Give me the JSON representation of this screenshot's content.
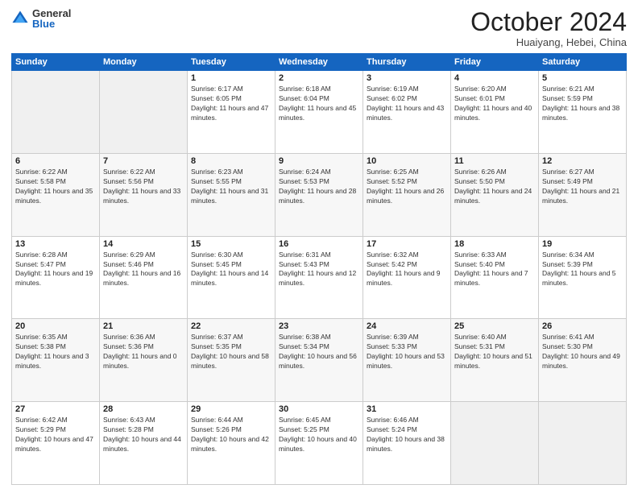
{
  "header": {
    "logo_general": "General",
    "logo_blue": "Blue",
    "month_title": "October 2024",
    "subtitle": "Huaiyang, Hebei, China"
  },
  "days_of_week": [
    "Sunday",
    "Monday",
    "Tuesday",
    "Wednesday",
    "Thursday",
    "Friday",
    "Saturday"
  ],
  "weeks": [
    [
      {
        "day": "",
        "info": ""
      },
      {
        "day": "",
        "info": ""
      },
      {
        "day": "1",
        "info": "Sunrise: 6:17 AM\nSunset: 6:05 PM\nDaylight: 11 hours and 47 minutes."
      },
      {
        "day": "2",
        "info": "Sunrise: 6:18 AM\nSunset: 6:04 PM\nDaylight: 11 hours and 45 minutes."
      },
      {
        "day": "3",
        "info": "Sunrise: 6:19 AM\nSunset: 6:02 PM\nDaylight: 11 hours and 43 minutes."
      },
      {
        "day": "4",
        "info": "Sunrise: 6:20 AM\nSunset: 6:01 PM\nDaylight: 11 hours and 40 minutes."
      },
      {
        "day": "5",
        "info": "Sunrise: 6:21 AM\nSunset: 5:59 PM\nDaylight: 11 hours and 38 minutes."
      }
    ],
    [
      {
        "day": "6",
        "info": "Sunrise: 6:22 AM\nSunset: 5:58 PM\nDaylight: 11 hours and 35 minutes."
      },
      {
        "day": "7",
        "info": "Sunrise: 6:22 AM\nSunset: 5:56 PM\nDaylight: 11 hours and 33 minutes."
      },
      {
        "day": "8",
        "info": "Sunrise: 6:23 AM\nSunset: 5:55 PM\nDaylight: 11 hours and 31 minutes."
      },
      {
        "day": "9",
        "info": "Sunrise: 6:24 AM\nSunset: 5:53 PM\nDaylight: 11 hours and 28 minutes."
      },
      {
        "day": "10",
        "info": "Sunrise: 6:25 AM\nSunset: 5:52 PM\nDaylight: 11 hours and 26 minutes."
      },
      {
        "day": "11",
        "info": "Sunrise: 6:26 AM\nSunset: 5:50 PM\nDaylight: 11 hours and 24 minutes."
      },
      {
        "day": "12",
        "info": "Sunrise: 6:27 AM\nSunset: 5:49 PM\nDaylight: 11 hours and 21 minutes."
      }
    ],
    [
      {
        "day": "13",
        "info": "Sunrise: 6:28 AM\nSunset: 5:47 PM\nDaylight: 11 hours and 19 minutes."
      },
      {
        "day": "14",
        "info": "Sunrise: 6:29 AM\nSunset: 5:46 PM\nDaylight: 11 hours and 16 minutes."
      },
      {
        "day": "15",
        "info": "Sunrise: 6:30 AM\nSunset: 5:45 PM\nDaylight: 11 hours and 14 minutes."
      },
      {
        "day": "16",
        "info": "Sunrise: 6:31 AM\nSunset: 5:43 PM\nDaylight: 11 hours and 12 minutes."
      },
      {
        "day": "17",
        "info": "Sunrise: 6:32 AM\nSunset: 5:42 PM\nDaylight: 11 hours and 9 minutes."
      },
      {
        "day": "18",
        "info": "Sunrise: 6:33 AM\nSunset: 5:40 PM\nDaylight: 11 hours and 7 minutes."
      },
      {
        "day": "19",
        "info": "Sunrise: 6:34 AM\nSunset: 5:39 PM\nDaylight: 11 hours and 5 minutes."
      }
    ],
    [
      {
        "day": "20",
        "info": "Sunrise: 6:35 AM\nSunset: 5:38 PM\nDaylight: 11 hours and 3 minutes."
      },
      {
        "day": "21",
        "info": "Sunrise: 6:36 AM\nSunset: 5:36 PM\nDaylight: 11 hours and 0 minutes."
      },
      {
        "day": "22",
        "info": "Sunrise: 6:37 AM\nSunset: 5:35 PM\nDaylight: 10 hours and 58 minutes."
      },
      {
        "day": "23",
        "info": "Sunrise: 6:38 AM\nSunset: 5:34 PM\nDaylight: 10 hours and 56 minutes."
      },
      {
        "day": "24",
        "info": "Sunrise: 6:39 AM\nSunset: 5:33 PM\nDaylight: 10 hours and 53 minutes."
      },
      {
        "day": "25",
        "info": "Sunrise: 6:40 AM\nSunset: 5:31 PM\nDaylight: 10 hours and 51 minutes."
      },
      {
        "day": "26",
        "info": "Sunrise: 6:41 AM\nSunset: 5:30 PM\nDaylight: 10 hours and 49 minutes."
      }
    ],
    [
      {
        "day": "27",
        "info": "Sunrise: 6:42 AM\nSunset: 5:29 PM\nDaylight: 10 hours and 47 minutes."
      },
      {
        "day": "28",
        "info": "Sunrise: 6:43 AM\nSunset: 5:28 PM\nDaylight: 10 hours and 44 minutes."
      },
      {
        "day": "29",
        "info": "Sunrise: 6:44 AM\nSunset: 5:26 PM\nDaylight: 10 hours and 42 minutes."
      },
      {
        "day": "30",
        "info": "Sunrise: 6:45 AM\nSunset: 5:25 PM\nDaylight: 10 hours and 40 minutes."
      },
      {
        "day": "31",
        "info": "Sunrise: 6:46 AM\nSunset: 5:24 PM\nDaylight: 10 hours and 38 minutes."
      },
      {
        "day": "",
        "info": ""
      },
      {
        "day": "",
        "info": ""
      }
    ]
  ]
}
